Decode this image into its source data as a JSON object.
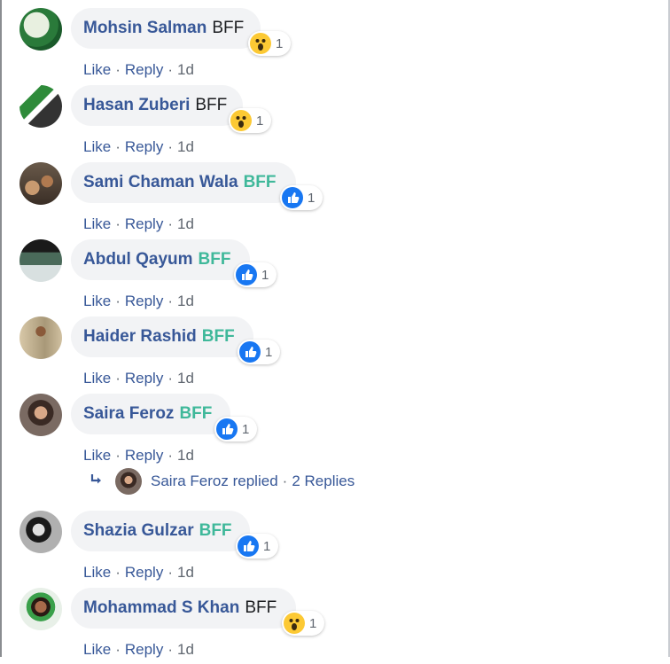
{
  "actions": {
    "like": "Like",
    "reply": "Reply",
    "sep": "·"
  },
  "comments": [
    {
      "name": "Mohsin Salman",
      "text": "BFF",
      "style": "plain",
      "reaction": "wow",
      "count": "1",
      "time": "1d"
    },
    {
      "name": "Hasan Zuberi",
      "text": "BFF",
      "style": "plain",
      "reaction": "wow",
      "count": "1",
      "time": "1d"
    },
    {
      "name": "Sami Chaman Wala",
      "text": "BFF",
      "style": "green",
      "reaction": "like",
      "count": "1",
      "time": "1d"
    },
    {
      "name": "Abdul Qayum",
      "text": "BFF",
      "style": "green",
      "reaction": "like",
      "count": "1",
      "time": "1d"
    },
    {
      "name": "Haider Rashid",
      "text": "BFF",
      "style": "green",
      "reaction": "like",
      "count": "1",
      "time": "1d"
    },
    {
      "name": "Saira Feroz",
      "text": "BFF",
      "style": "green",
      "reaction": "like",
      "count": "1",
      "time": "1d"
    },
    {
      "name": "Shazia Gulzar",
      "text": "BFF",
      "style": "green",
      "reaction": "like",
      "count": "1",
      "time": "1d"
    },
    {
      "name": "Mohammad S Khan",
      "text": "BFF",
      "style": "plain",
      "reaction": "wow",
      "count": "1",
      "time": "1d"
    }
  ],
  "replies": {
    "author": "Saira Feroz",
    "verb": "replied",
    "count_label": "2 Replies"
  },
  "colors": {
    "link": "#385898",
    "bubble": "#f2f3f5",
    "like": "#1877f2",
    "wow": "#fcc934",
    "green_text": "#3fb89a"
  }
}
